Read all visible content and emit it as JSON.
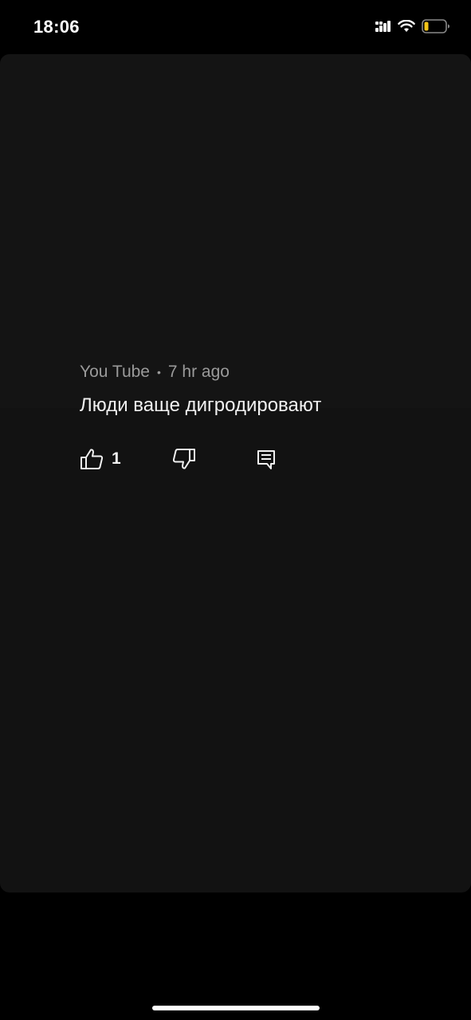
{
  "status_bar": {
    "time": "18:06",
    "icons": [
      "signal-icon",
      "wifi-icon",
      "battery-icon"
    ],
    "battery_level": 0.2,
    "battery_color": "#f5c518"
  },
  "comment": {
    "author": "You Tube",
    "separator": "•",
    "time_ago": "7 hr ago",
    "text": "Люди ваще дигродировают",
    "like_count": "1",
    "icons": [
      "thumbs-up-icon",
      "thumbs-down-icon",
      "reply-icon"
    ]
  },
  "colors": {
    "background": "#000000",
    "card": "#121212",
    "meta_text": "#9a9a9a",
    "primary_text": "#f1f1f1"
  }
}
